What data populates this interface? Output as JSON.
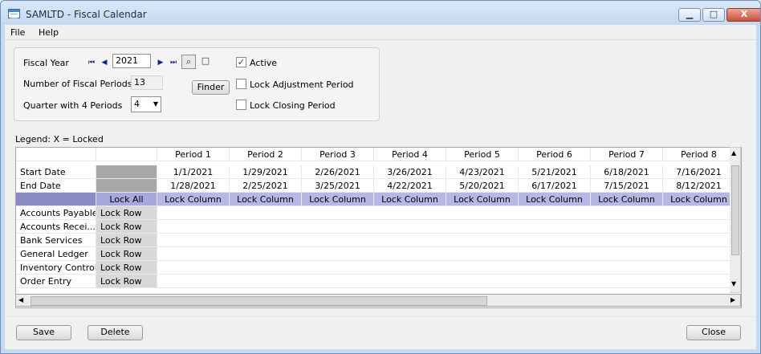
{
  "window": {
    "title": "SAMLTD - Fiscal Calendar",
    "controls": {
      "minimize": "▁",
      "maximize": "□",
      "close": "X"
    }
  },
  "menu": {
    "file": "File",
    "help": "Help"
  },
  "form": {
    "fiscal_year_label": "Fiscal Year",
    "fiscal_year_value": "2021",
    "num_periods_label": "Number of Fiscal Periods",
    "num_periods_value": "13",
    "quarter_label": "Quarter with 4 Periods",
    "quarter_value": "4",
    "finder_label": "Finder",
    "active_label": "Active",
    "active_checked": "✓",
    "lock_adjustment_label": "Lock Adjustment Period",
    "lock_closing_label": "Lock Closing Period"
  },
  "legend": "Legend: X = Locked",
  "grid": {
    "periods": [
      "Period 1",
      "Period 2",
      "Period 3",
      "Period 4",
      "Period 5",
      "Period 6",
      "Period 7",
      "Period 8"
    ],
    "start_label": "Start Date",
    "end_label": "End Date",
    "start_dates": [
      "1/1/2021",
      "1/29/2021",
      "2/26/2021",
      "3/26/2021",
      "4/23/2021",
      "5/21/2021",
      "6/18/2021",
      "7/16/2021"
    ],
    "end_dates": [
      "1/28/2021",
      "2/25/2021",
      "3/25/2021",
      "4/22/2021",
      "5/20/2021",
      "6/17/2021",
      "7/15/2021",
      "8/12/2021"
    ],
    "lock_all": "Lock All",
    "lock_column": "Lock Column",
    "lock_row": "Lock Row",
    "rows": [
      "Accounts Payable",
      "Accounts Recei...",
      "Bank Services",
      "General Ledger",
      "Inventory Control",
      "Order Entry"
    ]
  },
  "buttons": {
    "save": "Save",
    "delete": "Delete",
    "close": "Close"
  }
}
